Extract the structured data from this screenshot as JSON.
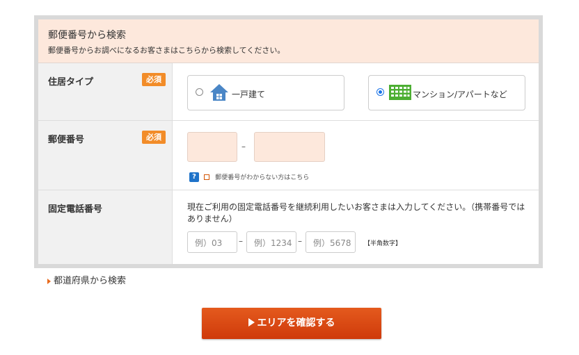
{
  "header": {
    "title": "郵便番号から検索",
    "subtitle": "郵便番号からお調べになるお客さまはこちらから検索してください。"
  },
  "required_label": "必須",
  "residence": {
    "label": "住居タイプ",
    "options": [
      {
        "label": "一戸建て",
        "icon": "house-icon",
        "selected": false
      },
      {
        "label": "マンション/アパートなど",
        "icon": "apartment-icon",
        "selected": true
      }
    ]
  },
  "postal": {
    "label": "郵便番号",
    "separator": "–",
    "help_icon": "?",
    "help_text": "郵便番号がわからない方はこちら"
  },
  "phone": {
    "label": "固定電話番号",
    "description": "現在ご利用の固定電話番号を継続利用したいお客さまは入力してください。（携帯番号ではありません）",
    "placeholders": [
      "例）03",
      "例）1234",
      "例）5678"
    ],
    "separator": "–",
    "note": "【半角数字】"
  },
  "prefecture_link": "都道府県から検索",
  "confirm_button": "エリアを確認する",
  "colors": {
    "accent": "#e05a1d",
    "badge": "#f28c28",
    "input_fill": "#fde8dc",
    "radio_selected": "#1a73e8"
  }
}
